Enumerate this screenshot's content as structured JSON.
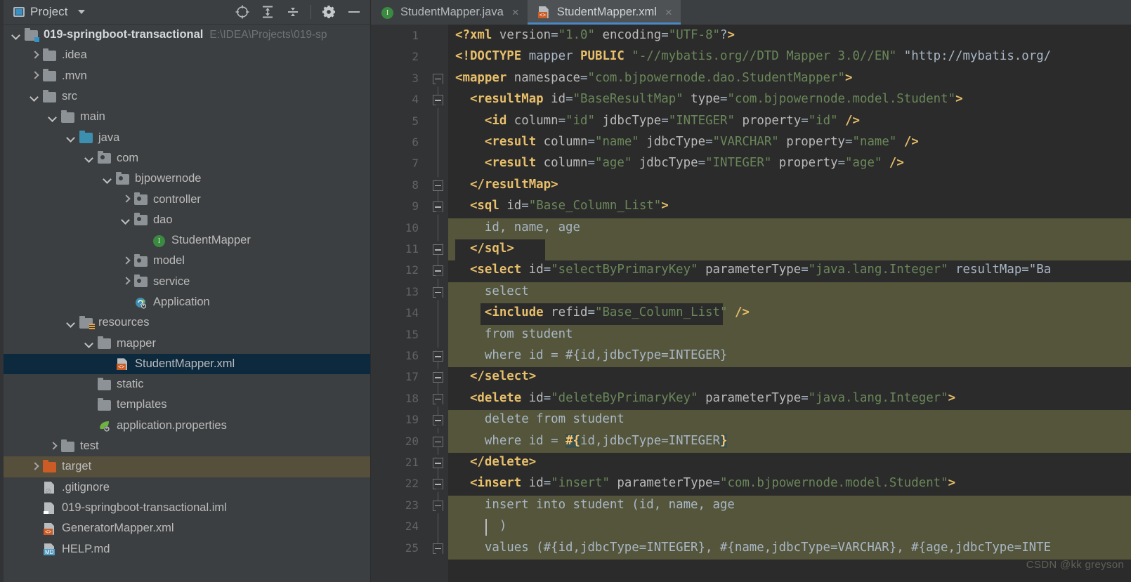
{
  "project_panel": {
    "title": "Project",
    "window_icon": "project-window-icon",
    "toolbar": [
      {
        "name": "locate-icon",
        "label": "Select Opened File"
      },
      {
        "name": "expand-all-icon",
        "label": "Expand All"
      },
      {
        "name": "collapse-all-icon",
        "label": "Collapse All"
      },
      {
        "name": "gear-icon",
        "label": "Settings"
      },
      {
        "name": "minimize-icon",
        "label": "Hide"
      }
    ],
    "tree": [
      {
        "label": "019-springboot-transactional",
        "path": "E:\\IDEA\\Projects\\019-sp",
        "depth": 0,
        "arrow": "down",
        "icon": "module-folder-icon",
        "bold": true
      },
      {
        "label": ".idea",
        "depth": 1,
        "arrow": "right",
        "icon": "folder-icon"
      },
      {
        "label": ".mvn",
        "depth": 1,
        "arrow": "right",
        "icon": "folder-icon"
      },
      {
        "label": "src",
        "depth": 1,
        "arrow": "down",
        "icon": "folder-icon"
      },
      {
        "label": "main",
        "depth": 2,
        "arrow": "down",
        "icon": "folder-icon"
      },
      {
        "label": "java",
        "depth": 3,
        "arrow": "down",
        "icon": "source-root-folder-icon"
      },
      {
        "label": "com",
        "depth": 4,
        "arrow": "down",
        "icon": "package-folder-icon"
      },
      {
        "label": "bjpowernode",
        "depth": 5,
        "arrow": "down",
        "icon": "package-folder-icon"
      },
      {
        "label": "controller",
        "depth": 6,
        "arrow": "right",
        "icon": "package-folder-icon"
      },
      {
        "label": "dao",
        "depth": 6,
        "arrow": "down",
        "icon": "package-folder-icon"
      },
      {
        "label": "StudentMapper",
        "depth": 7,
        "arrow": "none",
        "icon": "java-interface-icon"
      },
      {
        "label": "model",
        "depth": 6,
        "arrow": "right",
        "icon": "package-folder-icon"
      },
      {
        "label": "service",
        "depth": 6,
        "arrow": "right",
        "icon": "package-folder-icon"
      },
      {
        "label": "Application",
        "depth": 6,
        "arrow": "none",
        "icon": "spring-boot-class-icon"
      },
      {
        "label": "resources",
        "depth": 3,
        "arrow": "down",
        "icon": "resource-root-folder-icon"
      },
      {
        "label": "mapper",
        "depth": 4,
        "arrow": "down",
        "icon": "folder-icon"
      },
      {
        "label": "StudentMapper.xml",
        "depth": 5,
        "arrow": "none",
        "icon": "xml-file-icon",
        "selected": "blue"
      },
      {
        "label": "static",
        "depth": 4,
        "arrow": "none",
        "icon": "folder-icon"
      },
      {
        "label": "templates",
        "depth": 4,
        "arrow": "none",
        "icon": "folder-icon"
      },
      {
        "label": "application.properties",
        "depth": 4,
        "arrow": "none",
        "icon": "spring-properties-icon"
      },
      {
        "label": "test",
        "depth": 2,
        "arrow": "right",
        "icon": "folder-icon"
      },
      {
        "label": "target",
        "depth": 1,
        "arrow": "right",
        "icon": "excluded-folder-icon",
        "selected": "brown"
      },
      {
        "label": ".gitignore",
        "depth": 1,
        "arrow": "none",
        "icon": "gitignore-file-icon"
      },
      {
        "label": "019-springboot-transactional.iml",
        "depth": 1,
        "arrow": "none",
        "icon": "iml-file-icon"
      },
      {
        "label": "GeneratorMapper.xml",
        "depth": 1,
        "arrow": "none",
        "icon": "xml-file-icon"
      },
      {
        "label": "HELP.md",
        "depth": 1,
        "arrow": "none",
        "icon": "markdown-file-icon"
      }
    ]
  },
  "editor": {
    "tabs": [
      {
        "label": "StudentMapper.java",
        "icon": "java-interface-icon",
        "active": false,
        "close": "×"
      },
      {
        "label": "StudentMapper.xml",
        "icon": "xml-file-icon",
        "active": true,
        "close": "×"
      }
    ],
    "line_numbers": [
      "1",
      "2",
      "3",
      "4",
      "5",
      "6",
      "7",
      "8",
      "9",
      "10",
      "11",
      "12",
      "13",
      "14",
      "15",
      "16",
      "17",
      "18",
      "19",
      "20",
      "21",
      "22",
      "23",
      "24",
      "25"
    ],
    "lines": [
      {
        "n": 1,
        "text": "<?xml version=\"1.0\" encoding=\"UTF-8\"?>"
      },
      {
        "n": 2,
        "text": "<!DOCTYPE mapper PUBLIC \"-//mybatis.org//DTD Mapper 3.0//EN\" \"http://mybatis.org/"
      },
      {
        "n": 3,
        "text": "<mapper namespace=\"com.bjpowernode.dao.StudentMapper\">"
      },
      {
        "n": 4,
        "text": "  <resultMap id=\"BaseResultMap\" type=\"com.bjpowernode.model.Student\">"
      },
      {
        "n": 5,
        "text": "    <id column=\"id\" jdbcType=\"INTEGER\" property=\"id\" />"
      },
      {
        "n": 6,
        "text": "    <result column=\"name\" jdbcType=\"VARCHAR\" property=\"name\" />"
      },
      {
        "n": 7,
        "text": "    <result column=\"age\" jdbcType=\"INTEGER\" property=\"age\" />"
      },
      {
        "n": 8,
        "text": "  </resultMap>"
      },
      {
        "n": 9,
        "text": "  <sql id=\"Base_Column_List\">"
      },
      {
        "n": 10,
        "text": "    id, name, age"
      },
      {
        "n": 11,
        "text": "  </sql>"
      },
      {
        "n": 12,
        "text": "  <select id=\"selectByPrimaryKey\" parameterType=\"java.lang.Integer\" resultMap=\"Ba"
      },
      {
        "n": 13,
        "text": "    select"
      },
      {
        "n": 14,
        "text": "    <include refid=\"Base_Column_List\" />"
      },
      {
        "n": 15,
        "text": "    from student"
      },
      {
        "n": 16,
        "text": "    where id = #{id,jdbcType=INTEGER}"
      },
      {
        "n": 17,
        "text": "  </select>"
      },
      {
        "n": 18,
        "text": "  <delete id=\"deleteByPrimaryKey\" parameterType=\"java.lang.Integer\">"
      },
      {
        "n": 19,
        "text": "    delete from student"
      },
      {
        "n": 20,
        "text": "    where id = #{id,jdbcType=INTEGER}"
      },
      {
        "n": 21,
        "text": "  </delete>"
      },
      {
        "n": 22,
        "text": "  <insert id=\"insert\" parameterType=\"com.bjpowernode.model.Student\">"
      },
      {
        "n": 23,
        "text": "    insert into student (id, name, age"
      },
      {
        "n": 24,
        "text": "      )"
      },
      {
        "n": 25,
        "text": "    values (#{id,jdbcType=INTEGER}, #{name,jdbcType=VARCHAR}, #{age,jdbcType=INTE"
      }
    ],
    "watermark": "CSDN @kk greyson"
  },
  "colors": {
    "accent": "#3592c4",
    "tab_underline": "#4a88c7",
    "selection_blue": "#0d293e",
    "selection_brown": "#554f3c",
    "highlight_olive": "#54553a",
    "tag": "#e8bf6a",
    "value": "#6a8759",
    "plain": "#a9b7c6",
    "editor_bg": "#2b2b2b",
    "panel_bg": "#3c3f41"
  }
}
